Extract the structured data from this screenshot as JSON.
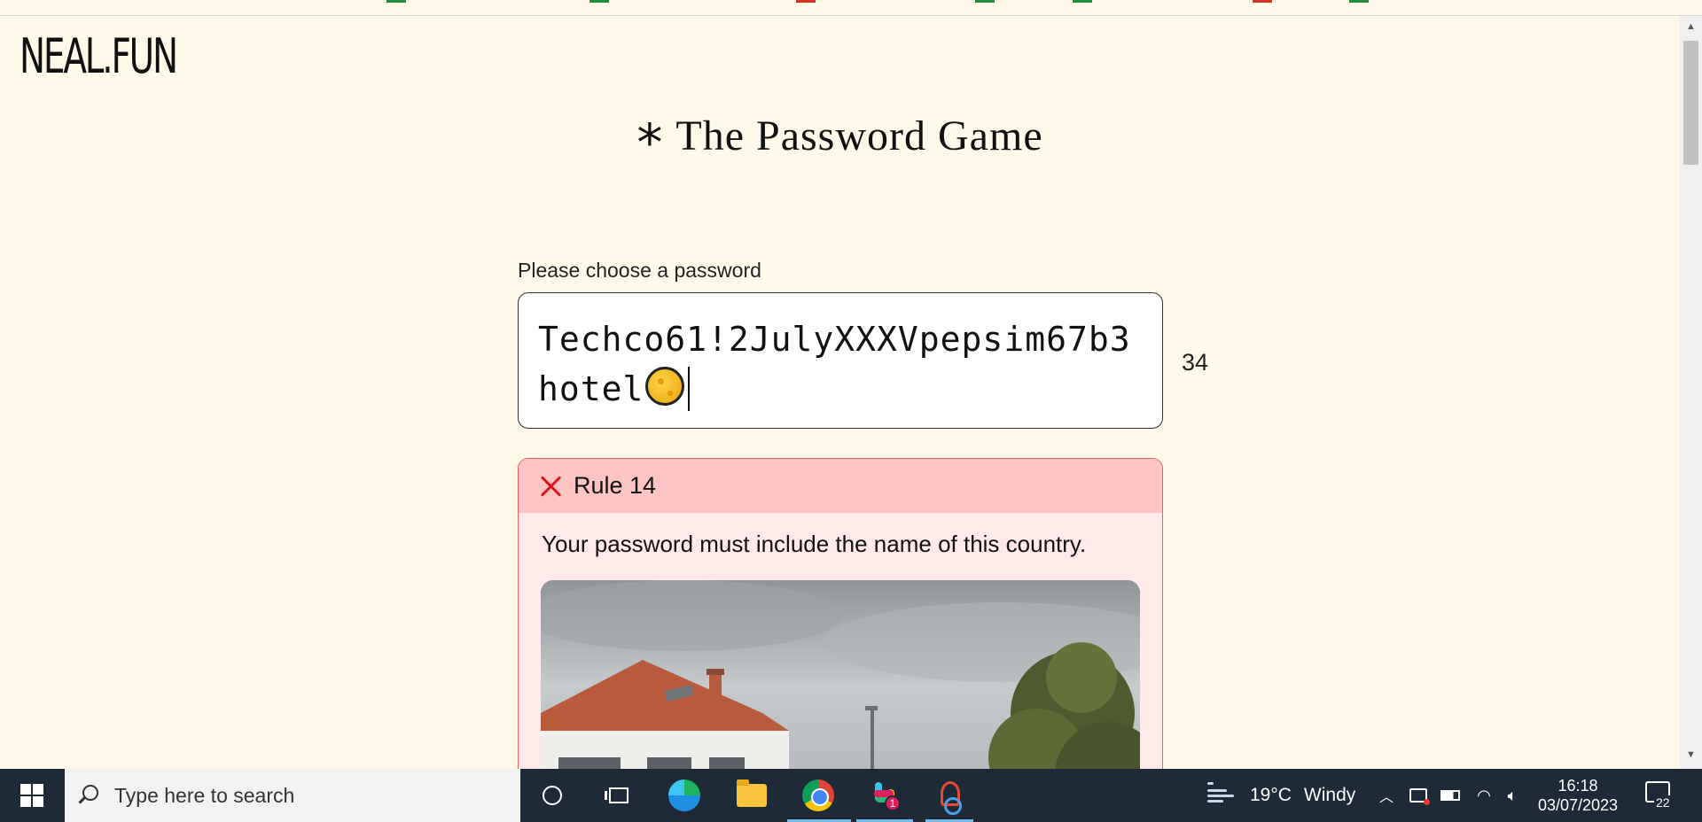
{
  "site": {
    "logo_text": "NEAL.FUN"
  },
  "game": {
    "title": "The Password Game",
    "star_glyph": "*",
    "password_label": "Please choose a password",
    "password_value": "Techco61!2JulyXXXVpepsim67b3hotel",
    "password_emoji": "moon-emoji",
    "char_count": "34"
  },
  "rule": {
    "status": "failed",
    "title": "Rule 14",
    "description": "Your password must include the name of this country.",
    "image": "street-view-photo"
  },
  "taskbar": {
    "search_placeholder": "Type here to search",
    "apps": [
      "cortana",
      "task-view",
      "edge",
      "file-explorer",
      "chrome",
      "slack",
      "snipping-tool"
    ],
    "slack_badge": "1",
    "weather_temp": "19°C",
    "weather_desc": "Windy",
    "time": "16:18",
    "date": "03/07/2023",
    "notification_count": "22"
  },
  "colors": {
    "page_bg": "#fef9e9",
    "rule_header_bg": "#ffc5c5",
    "rule_body_bg": "#ffe9e9",
    "rule_border": "#e56060",
    "fail_icon": "#e0121e",
    "taskbar_bg": "#1e2a38"
  }
}
